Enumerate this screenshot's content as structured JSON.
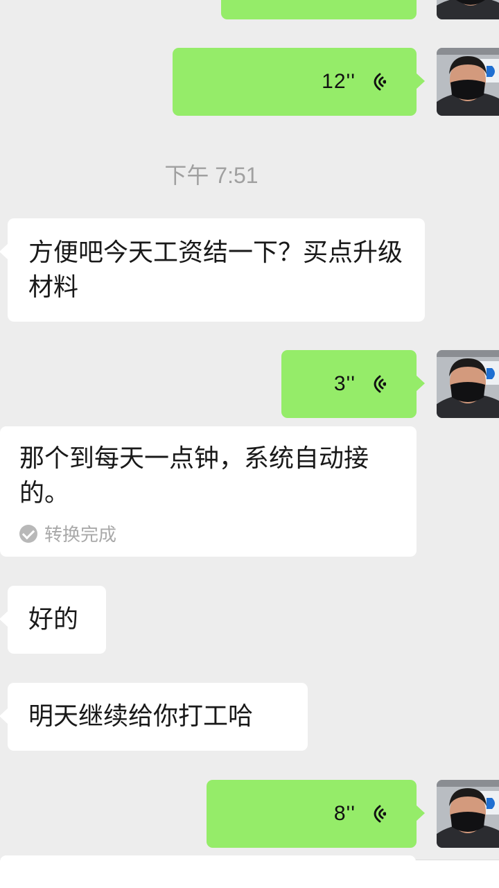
{
  "messages": [
    {
      "id": "m1",
      "side": "right",
      "kind": "voice",
      "duration": ""
    },
    {
      "id": "m2",
      "side": "right",
      "kind": "voice",
      "duration": "12''"
    },
    {
      "id": "m3",
      "side": "left",
      "kind": "text",
      "text": "方便吧今天工资结一下？买点升级材料"
    },
    {
      "id": "m4",
      "side": "right",
      "kind": "voice",
      "duration": "3''"
    },
    {
      "id": "m5",
      "side": "left",
      "kind": "transcription",
      "text": "那个到每天一点钟，系统自动接的。",
      "status": "转换完成"
    },
    {
      "id": "m6",
      "side": "left",
      "kind": "text",
      "text": "好的"
    },
    {
      "id": "m7",
      "side": "left",
      "kind": "text",
      "text": "明天继续给你打工哈"
    },
    {
      "id": "m8",
      "side": "right",
      "kind": "voice",
      "duration": "8''"
    }
  ],
  "timestamp": "下午 7:51",
  "colors": {
    "background": "#ededed",
    "outgoing_bubble": "#95ec69",
    "incoming_bubble": "#ffffff",
    "timestamp": "#a0a0a0",
    "status_text": "#a9a9a9"
  },
  "icons": {
    "voice": "voice-wave-icon",
    "status": "check-circle-icon",
    "avatar": "user-avatar-photo"
  }
}
